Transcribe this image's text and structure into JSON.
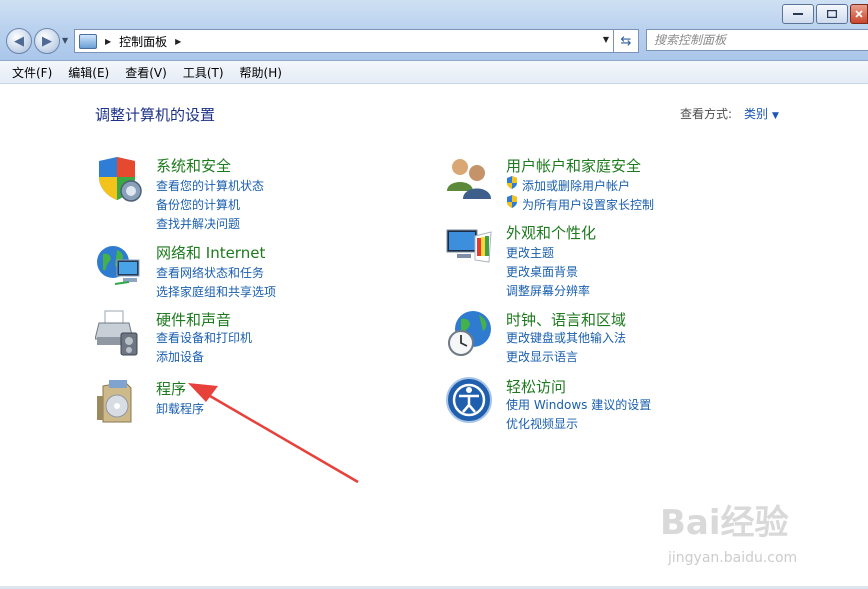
{
  "address": {
    "path": "控制面板",
    "search_placeholder": "搜索控制面板"
  },
  "menu": [
    "文件(F)",
    "编辑(E)",
    "查看(V)",
    "工具(T)",
    "帮助(H)"
  ],
  "heading": "调整计算机的设置",
  "view_by": {
    "label": "查看方式:",
    "value": "类别"
  },
  "categories": [
    {
      "title": "系统和安全",
      "links": [
        "查看您的计算机状态",
        "备份您的计算机",
        "查找并解决问题"
      ]
    },
    {
      "title": "网络和 Internet",
      "links": [
        "查看网络状态和任务",
        "选择家庭组和共享选项"
      ]
    },
    {
      "title": "硬件和声音",
      "links": [
        "查看设备和打印机",
        "添加设备"
      ]
    },
    {
      "title": "程序",
      "links": [
        "卸载程序"
      ]
    },
    {
      "title": "用户帐户和家庭安全",
      "links": [
        "添加或删除用户帐户",
        "为所有用户设置家长控制"
      ]
    },
    {
      "title": "外观和个性化",
      "links": [
        "更改主题",
        "更改桌面背景",
        "调整屏幕分辨率"
      ]
    },
    {
      "title": "时钟、语言和区域",
      "links": [
        "更改键盘或其他输入法",
        "更改显示语言"
      ]
    },
    {
      "title": "轻松访问",
      "links": [
        "使用 Windows 建议的设置",
        "优化视频显示"
      ]
    }
  ],
  "watermark": {
    "brand": "Bai经验",
    "url": "jingyan.baidu.com"
  },
  "colors": {
    "category_title": "#1e7a1e",
    "link": "#1a5fae",
    "heading": "#1e3287",
    "annotation_arrow": "#e8403a"
  }
}
